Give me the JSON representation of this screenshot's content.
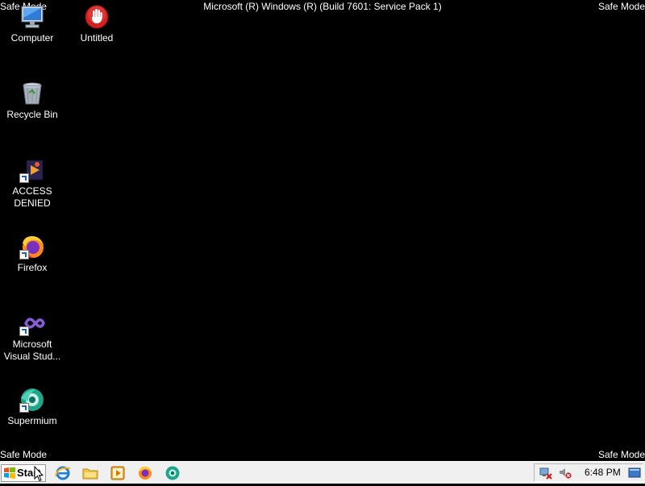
{
  "screen": {
    "title": "Microsoft (R) Windows (R) (Build 7601: Service Pack 1)",
    "safe_mode_label": "Safe Mode"
  },
  "desktop_icons": [
    {
      "label": "Computer",
      "icon": "computer-icon"
    },
    {
      "label": "Untitled",
      "icon": "stop-hand-icon"
    },
    {
      "label": "Recycle Bin",
      "icon": "recycle-bin-icon"
    },
    {
      "label": "ACCESS DENIED",
      "icon": "media-shortcut-icon"
    },
    {
      "label": "Firefox",
      "icon": "firefox-icon"
    },
    {
      "label": "Microsoft Visual Stud...",
      "icon": "visual-studio-icon"
    },
    {
      "label": "Supermium",
      "icon": "supermium-icon"
    }
  ],
  "taskbar": {
    "start_label": "Start",
    "quick_launch": [
      {
        "icon": "internet-explorer-icon"
      },
      {
        "icon": "file-explorer-icon"
      },
      {
        "icon": "media-player-icon"
      },
      {
        "icon": "firefox-icon"
      },
      {
        "icon": "supermium-icon"
      }
    ],
    "tray": {
      "icons": [
        "network-disconnected-icon",
        "volume-muted-icon",
        "show-desktop-icon"
      ],
      "clock": "6:48 PM"
    }
  },
  "colors": {
    "desktop_bg": "#000000",
    "taskbar_bg": "#f0f0f0",
    "text": "#ffffff"
  }
}
